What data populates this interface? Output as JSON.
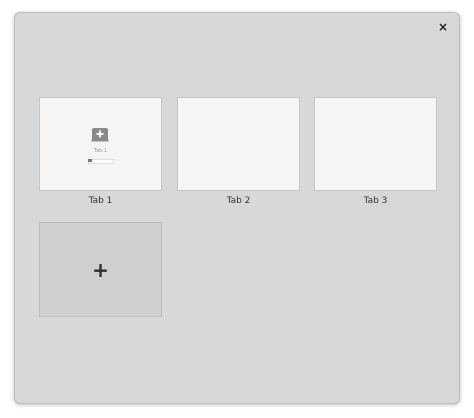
{
  "window": {
    "close_icon": "×"
  },
  "tabs": [
    {
      "label": "Tab 1",
      "preview": {
        "icon": "new-tab-icon",
        "text": "Tab 1"
      }
    },
    {
      "label": "Tab 2"
    },
    {
      "label": "Tab 3"
    }
  ],
  "add_tab": {
    "icon": "+"
  }
}
